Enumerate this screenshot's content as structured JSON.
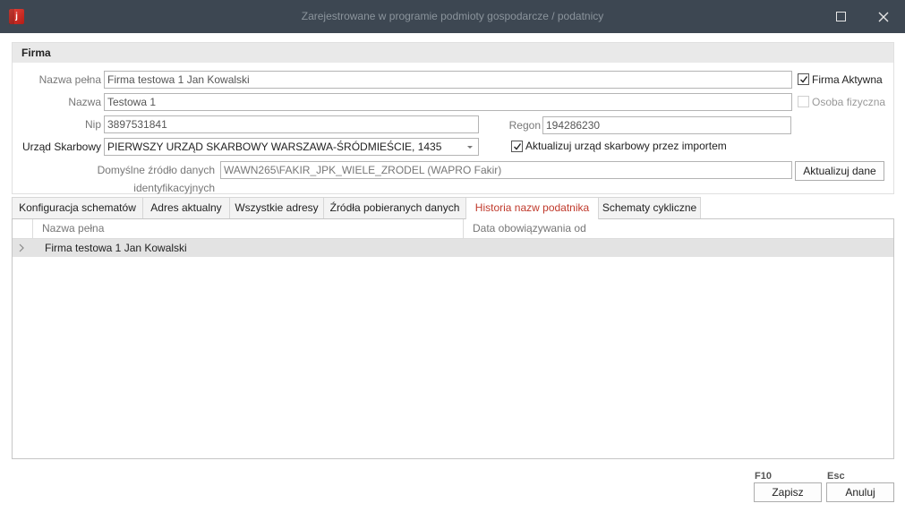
{
  "window": {
    "title": "Zarejestrowane w programie podmioty gospodarcze / podatnicy",
    "app_icon_letter": "j",
    "icons": {
      "app": "app-icon",
      "maximize": "maximize-icon",
      "close": "close-icon"
    }
  },
  "firma": {
    "header": "Firma",
    "nazwa_pelna_label": "Nazwa pełna",
    "nazwa_pelna_value": "Firma testowa 1 Jan Kowalski",
    "nazwa_label": "Nazwa",
    "nazwa_value": "Testowa 1",
    "nip_label": "Nip",
    "nip_value": "3897531841",
    "regon_label": "Regon",
    "regon_value": "194286230",
    "urzad_label": "Urząd Skarbowy",
    "urzad_value": "PIERWSZY URZĄD SKARBOWY WARSZAWA-ŚRÓDMIEŚCIE, 1435",
    "zrodlo_label": "Domyślne źródło danych identyfikacyjnych",
    "zrodlo_value": "WAWN265\\FAKIR_JPK_WIELE_ZRODEL (WAPRO Fakir)",
    "firma_aktywna_label": "Firma Aktywna",
    "firma_aktywna_checked": true,
    "osoba_fizyczna_label": "Osoba fizyczna",
    "osoba_fizyczna_checked": false,
    "aktualizuj_us_label": "Aktualizuj urząd skarbowy przez importem",
    "aktualizuj_us_checked": true,
    "aktualizuj_dane_button": "Aktualizuj dane"
  },
  "tabs": [
    {
      "label": "Konfiguracja schematów",
      "active": false
    },
    {
      "label": "Adres aktualny",
      "active": false
    },
    {
      "label": "Wszystkie adresy",
      "active": false
    },
    {
      "label": "Źródła pobieranych danych",
      "active": false
    },
    {
      "label": "Historia nazw podatnika",
      "active": true
    },
    {
      "label": "Schematy cykliczne",
      "active": false
    }
  ],
  "grid": {
    "columns": [
      "Nazwa pełna",
      "Data obowiązywania od"
    ],
    "rows": [
      {
        "nazwa": "Firma testowa 1 Jan Kowalski",
        "data": ""
      }
    ]
  },
  "footer": {
    "save_key": "F10",
    "save_label": "Zapisz",
    "cancel_key": "Esc",
    "cancel_label": "Anuluj"
  },
  "colors": {
    "titlebar": "#3d4752",
    "active_tab_text": "#c0392b",
    "selected_row": "#e3e3e3"
  }
}
